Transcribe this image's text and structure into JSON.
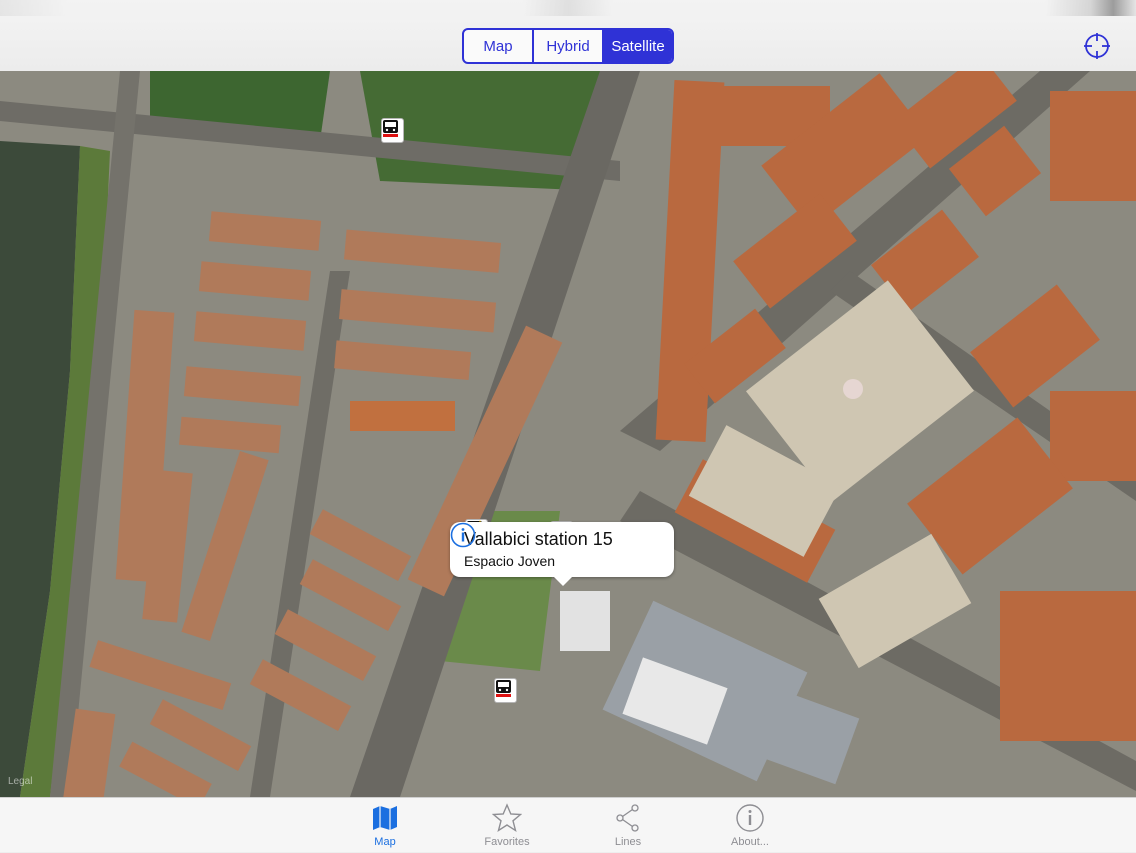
{
  "toolbar": {
    "segments": [
      {
        "label": "Map",
        "selected": false
      },
      {
        "label": "Hybrid",
        "selected": false
      },
      {
        "label": "Satellite",
        "selected": true
      }
    ],
    "locate_icon": "crosshair-locate-icon",
    "accent_color": "#2f32d6"
  },
  "map": {
    "type": "satellite",
    "legal_text": "Legal",
    "markers": [
      {
        "kind": "bus-stop",
        "icon": "bus-icon",
        "favorite": false
      },
      {
        "kind": "bus-stop",
        "icon": "bus-icon",
        "favorite": true
      },
      {
        "kind": "bike-station",
        "icon": "bicycle-icon",
        "favorite": true,
        "selected": true
      },
      {
        "kind": "bus-stop",
        "icon": "bus-icon",
        "favorite": false
      }
    ],
    "callout": {
      "title": "Vallabici station 15",
      "subtitle": "Espacio Joven",
      "info_icon": "info-icon"
    }
  },
  "tabbar": {
    "accent_color": "#1b6fe0",
    "tabs": [
      {
        "label": "Map",
        "icon": "map-icon",
        "active": true
      },
      {
        "label": "Favorites",
        "icon": "star-icon",
        "active": false
      },
      {
        "label": "Lines",
        "icon": "share-nodes-icon",
        "active": false
      },
      {
        "label": "About...",
        "icon": "info-icon",
        "active": false
      }
    ]
  }
}
